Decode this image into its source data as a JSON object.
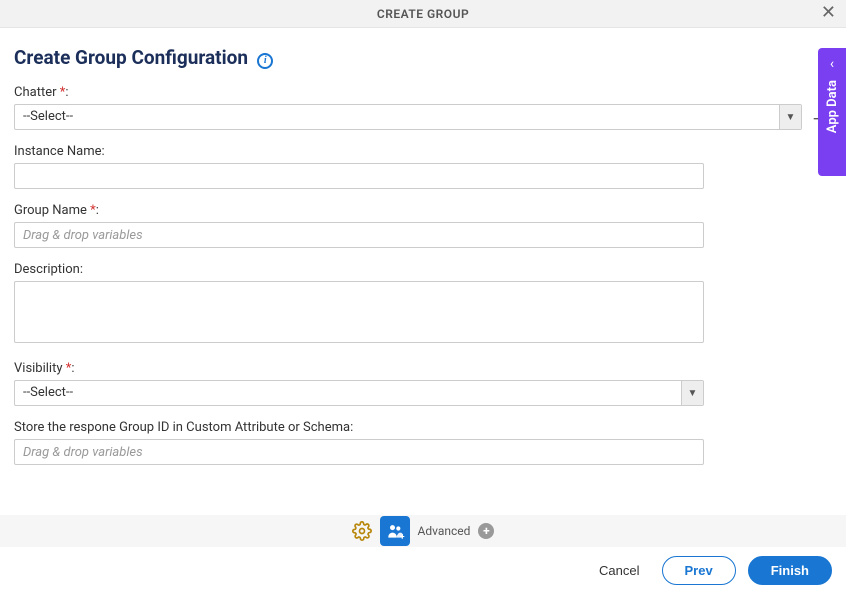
{
  "header": {
    "title": "CREATE GROUP"
  },
  "page": {
    "title": "Create Group Configuration"
  },
  "fields": {
    "chatter": {
      "label": "Chatter",
      "required": "*",
      "colon": ":",
      "value": "--Select--"
    },
    "instanceName": {
      "label": "Instance Name:",
      "value": ""
    },
    "groupName": {
      "label": "Group Name",
      "required": "*",
      "colon": ":",
      "placeholder": "Drag & drop variables",
      "value": ""
    },
    "description": {
      "label": "Description:",
      "value": ""
    },
    "visibility": {
      "label": "Visibility",
      "required": "*",
      "colon": ":",
      "value": "--Select--"
    },
    "storeGroupId": {
      "label": "Store the respone Group ID in Custom Attribute or Schema:",
      "placeholder": "Drag & drop variables",
      "value": ""
    }
  },
  "bottomBar": {
    "advanced": "Advanced"
  },
  "footer": {
    "cancel": "Cancel",
    "prev": "Prev",
    "finish": "Finish"
  },
  "sidebar": {
    "label": "App Data"
  }
}
